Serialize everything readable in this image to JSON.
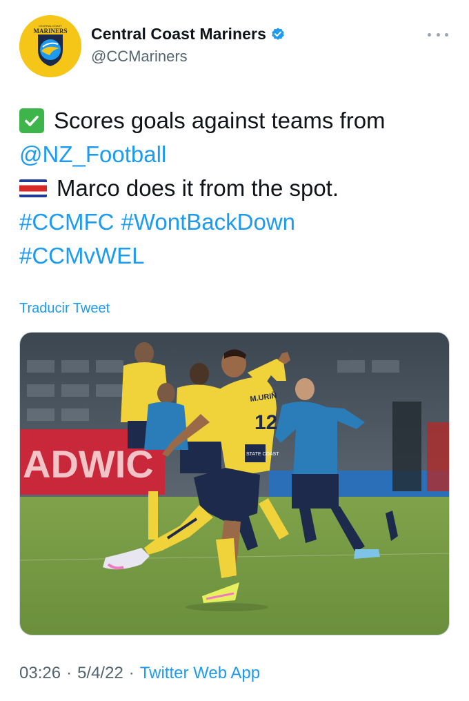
{
  "author": {
    "display_name": "Central Coast Mariners",
    "handle": "@CCMariners",
    "verified": true,
    "avatar_icon": "mariners-logo",
    "avatar_text": "MARINERS",
    "avatar_subtext": "CENTRAL COAST",
    "avatar_bg": "#f5c518"
  },
  "tweet": {
    "line1_prefix_icon": "check-mark-emoji",
    "line1_text": "Scores goals against teams from",
    "line2_mention": "@NZ_Football",
    "line3_prefix_icon": "costa-rica-flag-emoji",
    "line3_text": "Marco does it from the spot.",
    "hashtags_line4": [
      "#CCMFC",
      "#WontBackDown"
    ],
    "hashtags_line5": [
      "#CCMvWEL"
    ]
  },
  "translate_label": "Traducir Tweet",
  "media": {
    "type": "photo",
    "description_icon": "football-penalty-photo",
    "ad_board_text": "ADWIC",
    "jersey_name": "M.URIÑ",
    "jersey_number": "12",
    "jersey_sponsor": "STATE COAST"
  },
  "meta": {
    "time": "03:26",
    "separator": "·",
    "date": "5/4/22",
    "source": "Twitter Web App"
  },
  "colors": {
    "link": "#1d9bf0",
    "secondary_text": "#536471",
    "primary_text": "#0f1419"
  }
}
